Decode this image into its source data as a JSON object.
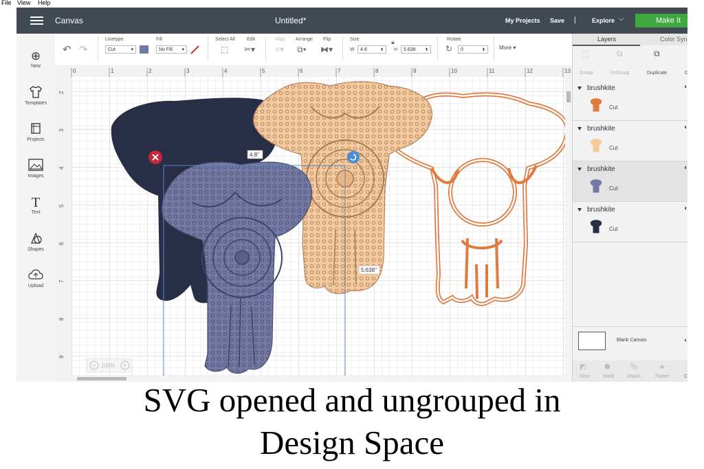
{
  "os_menu": [
    "File",
    "View",
    "Help"
  ],
  "header": {
    "app_name": "Canvas",
    "doc_title": "Untitled*",
    "my_projects": "My Projects",
    "save": "Save",
    "divider": "|",
    "machine": "Explore",
    "make_it": "Make It"
  },
  "toolbar": {
    "linetype_label": "Linetype",
    "linetype_value": "Cut",
    "linetype_color": "#6e7ba6",
    "fill_label": "Fill",
    "fill_value": "No Fill",
    "select_all": "Select All",
    "edit": "Edit",
    "align": "Align",
    "arrange": "Arrange",
    "flip": "Flip",
    "size_label": "Size",
    "w_label": "W",
    "w_value": "4.8",
    "h_label": "H",
    "h_value": "5.638",
    "rotate_label": "Rotate",
    "rotate_value": "0",
    "more": "More"
  },
  "left_nav": [
    {
      "label": "New",
      "icon": "plus-circle-icon"
    },
    {
      "label": "Templates",
      "icon": "tshirt-icon"
    },
    {
      "label": "Projects",
      "icon": "projects-icon"
    },
    {
      "label": "Images",
      "icon": "image-icon"
    },
    {
      "label": "Text",
      "icon": "text-icon"
    },
    {
      "label": "Shapes",
      "icon": "shapes-icon"
    },
    {
      "label": "Upload",
      "icon": "cloud-upload-icon"
    }
  ],
  "ruler": {
    "top": [
      "0",
      "1",
      "2",
      "3",
      "4",
      "5",
      "6",
      "7",
      "8",
      "9",
      "10",
      "11",
      "12",
      "13"
    ],
    "left": [
      "2",
      "3",
      "4",
      "5",
      "6",
      "7",
      "8",
      "9"
    ]
  },
  "canvas": {
    "width_tag": "4.8\"",
    "height_tag": "5.638\"",
    "zoom": "100%",
    "colors": {
      "dark": "#272e45",
      "periwinkle": "#7479a3",
      "peach": "#f6c99d",
      "orange": "#e07a3f",
      "grid": "#c9c9c9"
    }
  },
  "right_panel": {
    "tabs": [
      "Layers",
      "Color Sync"
    ],
    "tools": [
      "Group",
      "UnGroup",
      "Duplicate",
      "D"
    ],
    "layers": [
      {
        "name": "brushkite",
        "op": "Cut",
        "swatch": "#e07a3f"
      },
      {
        "name": "brushkite",
        "op": "Cut",
        "swatch": "#f6c99d"
      },
      {
        "name": "brushkite",
        "op": "Cut",
        "swatch": "#7479a3"
      },
      {
        "name": "brushkite",
        "op": "Cut",
        "swatch": "#272e45"
      }
    ],
    "blank_canvas": "Blank Canvas",
    "bottom_tools": [
      "Slice",
      "Weld",
      "Attach",
      "Flatten",
      "C"
    ]
  },
  "caption": {
    "line1": "SVG opened and ungrouped in",
    "line2": "Design Space"
  }
}
